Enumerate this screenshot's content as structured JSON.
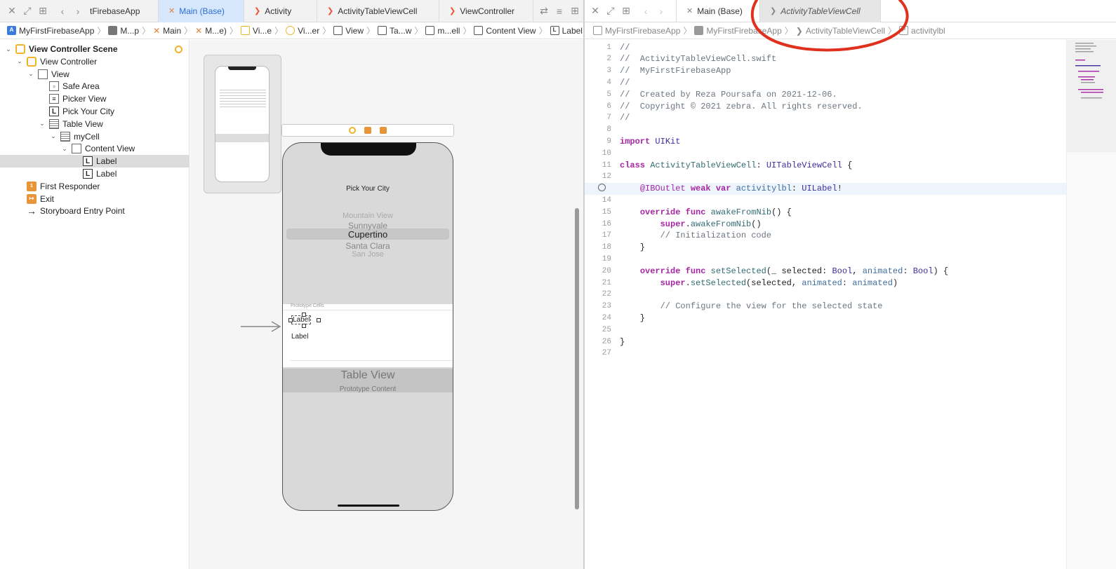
{
  "left_tabs": {
    "tabs": [
      {
        "label": "tFirebaseApp",
        "icon": "none",
        "active": false
      },
      {
        "label": "Main (Base)",
        "icon": "storyboard-icon",
        "active": true
      },
      {
        "label": "Activity",
        "icon": "swift-icon",
        "active": false
      },
      {
        "label": "ActivityTableViewCell",
        "icon": "swift-icon",
        "active": false
      },
      {
        "label": "ViewController",
        "icon": "swift-icon",
        "active": false
      }
    ]
  },
  "left_path": [
    "MyFirstFirebaseApp",
    "M...p",
    "Main",
    "M...e)",
    "Vi...e",
    "Vi...er",
    "View",
    "Ta...w",
    "m...ell",
    "Content View",
    "Label"
  ],
  "outline": {
    "items": [
      {
        "label": "View Controller Scene",
        "level": 0,
        "icon": "scene-icon",
        "disclosure": "open",
        "selected": false
      },
      {
        "label": "View Controller",
        "level": 1,
        "icon": "viewcontroller-icon",
        "disclosure": "open",
        "selected": false
      },
      {
        "label": "View",
        "level": 2,
        "icon": "view-icon",
        "disclosure": "open",
        "selected": false
      },
      {
        "label": "Safe Area",
        "level": 3,
        "icon": "safearea-icon",
        "disclosure": "none",
        "selected": false
      },
      {
        "label": "Picker View",
        "level": 3,
        "icon": "picker-icon",
        "disclosure": "none",
        "selected": false
      },
      {
        "label": "Pick Your City",
        "level": 3,
        "icon": "label-icon",
        "disclosure": "none",
        "selected": false
      },
      {
        "label": "Table View",
        "level": 3,
        "icon": "tableview-icon",
        "disclosure": "open",
        "selected": false
      },
      {
        "label": "myCell",
        "level": 4,
        "icon": "tablecell-icon",
        "disclosure": "open",
        "selected": false
      },
      {
        "label": "Content View",
        "level": 5,
        "icon": "view-icon",
        "disclosure": "open",
        "selected": false
      },
      {
        "label": "Label",
        "level": 6,
        "icon": "label-icon",
        "disclosure": "none",
        "selected": true
      },
      {
        "label": "Label",
        "level": 6,
        "icon": "label-icon",
        "disclosure": "none",
        "selected": false
      },
      {
        "label": "First Responder",
        "level": 1,
        "icon": "firstresponder-icon",
        "disclosure": "none",
        "selected": false
      },
      {
        "label": "Exit",
        "level": 1,
        "icon": "exit-icon",
        "disclosure": "none",
        "selected": false
      },
      {
        "label": "Storyboard Entry Point",
        "level": 1,
        "icon": "arrow-right-icon",
        "disclosure": "none",
        "selected": false
      }
    ]
  },
  "canvas": {
    "title": "Pick Your City",
    "picker_items": [
      "Mountain View",
      "Sunnyvale",
      "Cupertino",
      "Santa Clara",
      "San Jose"
    ],
    "selected_city": "Cupertino",
    "prototype_cells_label": "Prototype Cells",
    "cell_label_1": "Label",
    "cell_label_2": "Label",
    "table_view_label": "Table View",
    "prototype_content_label": "Prototype Content"
  },
  "right_tabs": {
    "tabs": [
      {
        "label": "Main (Base)",
        "icon": "storyboard-icon",
        "active": false
      },
      {
        "label": "ActivityTableViewCell",
        "icon": "swift-icon",
        "active": true,
        "italic": true
      }
    ]
  },
  "right_path": [
    "MyFirstFirebaseApp",
    "MyFirstFirebaseApp",
    "ActivityTableViewCell",
    "activitylbl"
  ],
  "code": {
    "lines": [
      "//",
      "//  ActivityTableViewCell.swift",
      "//  MyFirstFirebaseApp",
      "//",
      "//  Created by Reza Poursafa on 2021-12-06.",
      "//  Copyright © 2021 zebra. All rights reserved.",
      "//",
      "",
      "import UIKit",
      "",
      "class ActivityTableViewCell: UITableViewCell {",
      "",
      "    @IBOutlet weak var activitylbl: UILabel!",
      "",
      "    override func awakeFromNib() {",
      "        super.awakeFromNib()",
      "        // Initialization code",
      "    }",
      "",
      "    override func setSelected(_ selected: Bool, animated: Bool) {",
      "        super.setSelected(selected, animated: animated)",
      "",
      "        // Configure the view for the selected state",
      "    }",
      "",
      "}",
      ""
    ],
    "highlighted_line": 13
  },
  "annotation_color": "#e0301e"
}
